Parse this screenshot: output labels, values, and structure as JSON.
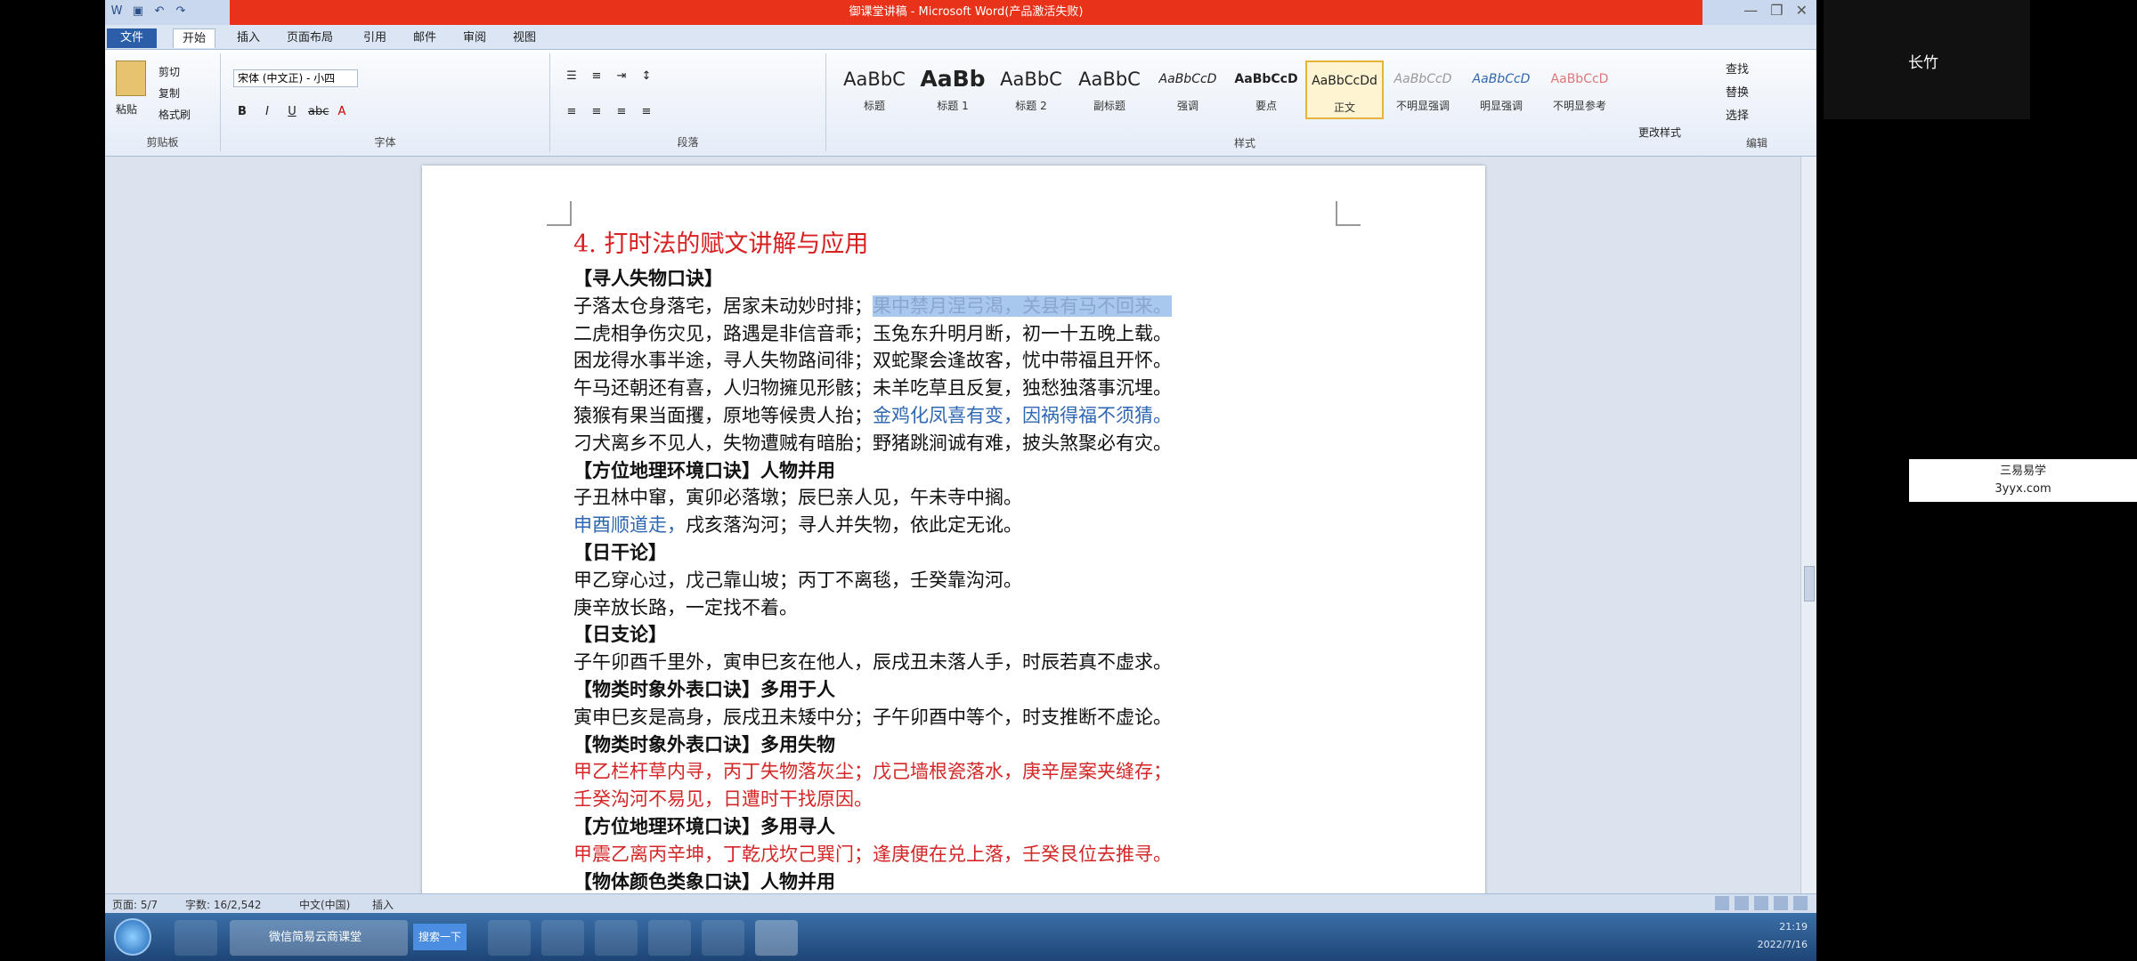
{
  "window": {
    "title": "御课堂讲稿 - Microsoft Word(产品激活失败)",
    "qat_icons": [
      "word-icon",
      "save-icon",
      "undo-icon",
      "redo-icon"
    ]
  },
  "tabs": [
    "文件",
    "开始",
    "插入",
    "页面布局",
    "引用",
    "邮件",
    "审阅",
    "视图"
  ],
  "active_tab": "开始",
  "ribbon": {
    "clipboard": {
      "paste": "粘贴",
      "cut": "剪切",
      "copy": "复制",
      "format_painter": "格式刷",
      "label": "剪贴板"
    },
    "font": {
      "font_name": "宋体 (中文正) - 小四",
      "label": "字体"
    },
    "paragraph": {
      "label": "段落"
    },
    "styles": {
      "label": "样式",
      "items": [
        {
          "sample": "AaBbC",
          "name": "标题"
        },
        {
          "sample": "AaBb",
          "name": "标题 1"
        },
        {
          "sample": "AaBbC",
          "name": "标题 2"
        },
        {
          "sample": "AaBbC",
          "name": "副标题"
        },
        {
          "sample": "AaBbCcD",
          "name": "强调"
        },
        {
          "sample": "AaBbCcD",
          "name": "要点"
        },
        {
          "sample": "AaBbCcDd",
          "name": "正文"
        },
        {
          "sample": "AaBbCcD",
          "name": "不明显强调"
        },
        {
          "sample": "AaBbCcD",
          "name": "明显强调"
        },
        {
          "sample": "AaBbCcD",
          "name": "不明显参考"
        }
      ],
      "change_styles": "更改样式"
    },
    "editing": {
      "find": "查找",
      "replace": "替换",
      "select": "选择",
      "label": "编辑"
    }
  },
  "document": {
    "heading": "4. 打时法的赋文讲解与应用",
    "lines": [
      {
        "style": "bold",
        "text": "【寻人失物口诀】"
      },
      {
        "style": "mixed",
        "parts": [
          {
            "t": "子落太仓身落宅，居家未动妙时排；",
            "c": ""
          },
          {
            "t": "果中禁月涅弓渴，关县有马不回来。",
            "c": "hl"
          }
        ]
      },
      {
        "style": "plain",
        "text": "二虎相争伤灾见，路遇是非信音乖；玉兔东升明月断，初一十五晚上载。"
      },
      {
        "style": "plain",
        "text": "困龙得水事半途，寻人失物路间徘；双蛇聚会逢故客，忧中带福且开怀。"
      },
      {
        "style": "plain",
        "text": "午马还朝还有喜，人归物擁见形骸；未羊吃草且反复，独愁独落事沉埋。"
      },
      {
        "style": "mixed",
        "parts": [
          {
            "t": "猿猴有果当面攫，原地等候贵人抬；",
            "c": ""
          },
          {
            "t": "金鸡化凤喜有变，因祸得福不须猜。",
            "c": "blue"
          }
        ]
      },
      {
        "style": "plain",
        "text": "刁犬离乡不见人，失物遭贼有暗胎；野猪跳涧诚有难，披头煞聚必有灾。"
      },
      {
        "style": "bold",
        "text": "【方位地理环境口诀】人物并用"
      },
      {
        "style": "plain",
        "text": "子丑林中窜，寅卯必落墩；辰巳亲人见，午未寺中搁。"
      },
      {
        "style": "mixed",
        "parts": [
          {
            "t": "申酉顺道走，",
            "c": "blue"
          },
          {
            "t": "戌亥落沟河；寻人并失物，依此定无讹。",
            "c": ""
          }
        ]
      },
      {
        "style": "bold",
        "text": "【日干论】"
      },
      {
        "style": "plain",
        "text": "甲乙穿心过，戊己靠山坡；丙丁不离毯，壬癸靠沟河。"
      },
      {
        "style": "plain",
        "text": "庚辛放长路，一定找不着。"
      },
      {
        "style": "bold",
        "text": "【日支论】"
      },
      {
        "style": "plain",
        "text": "子午卯酉千里外，寅申巳亥在他人，辰戌丑未落人手，时辰若真不虚求。"
      },
      {
        "style": "bold",
        "text": "【物类时象外表口诀】多用于人"
      },
      {
        "style": "plain",
        "text": "寅申巳亥是高身，辰戌丑未矮中分；子午卯酉中等个，时支推断不虚论。"
      },
      {
        "style": "bold",
        "text": "【物类时象外表口诀】多用失物"
      },
      {
        "style": "red",
        "text": "甲乙栏杆草内寻，丙丁失物落灰尘；戊己墙根瓷落水，庚辛屋案夹缝存；"
      },
      {
        "style": "red",
        "text": "壬癸沟河不易见，日遭时干找原因。"
      },
      {
        "style": "bold",
        "text": "【方位地理环境口诀】多用寻人"
      },
      {
        "style": "red",
        "text": "甲震乙离丙辛坤，丁乾戊坎己巽门；逢庚便在兑上落，壬癸艮位去推寻。"
      },
      {
        "style": "bold",
        "text": "【物体颜色类象口诀】人物并用"
      }
    ]
  },
  "statusbar": {
    "page": "页面: 5/7",
    "words": "字数: 16/2,542",
    "language": "中文(中国)",
    "mode": "插入"
  },
  "taskbar": {
    "ie_label": "微信简易云商课堂",
    "search_btn": "搜索一下",
    "time": "21:19",
    "date": "2022/7/16"
  },
  "overlay": {
    "user_name": "长竹",
    "watermark_title": "三易易学",
    "watermark_url": "3yyx.com"
  }
}
